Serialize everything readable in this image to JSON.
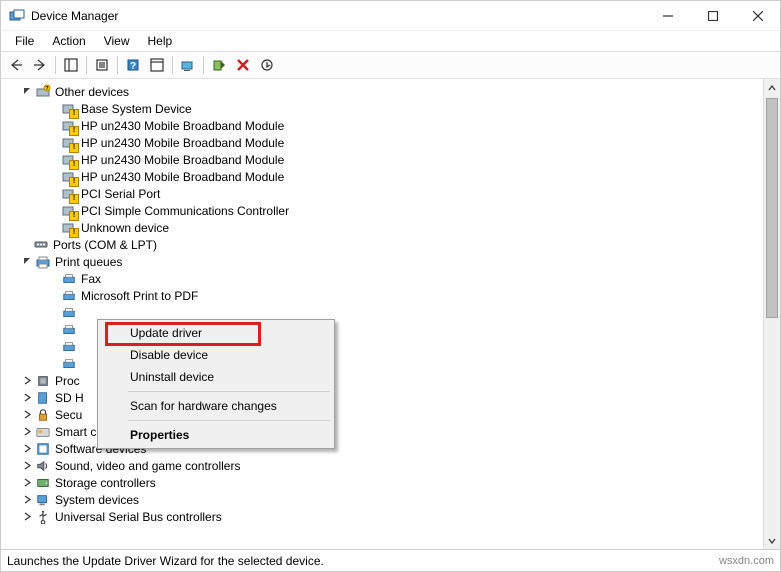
{
  "window": {
    "title": "Device Manager"
  },
  "menubar": {
    "file": "File",
    "action": "Action",
    "view": "View",
    "help": "Help"
  },
  "tree": {
    "other_devices": {
      "label": "Other devices",
      "children": {
        "base_system": "Base System Device",
        "hp1": "HP un2430 Mobile Broadband Module",
        "hp2": "HP un2430 Mobile Broadband Module",
        "hp3": "HP un2430 Mobile Broadband Module",
        "hp4": "HP un2430 Mobile Broadband Module",
        "pci_serial": "PCI Serial Port",
        "pci_simple": "PCI Simple Communications Controller",
        "unknown": "Unknown device"
      }
    },
    "ports": {
      "label": "Ports (COM & LPT)"
    },
    "print_queues": {
      "label": "Print queues",
      "children": {
        "fax": "Fax",
        "mspdf": "Microsoft Print to PDF",
        "p1": "",
        "p2": "",
        "p3": "",
        "p4": ""
      }
    },
    "proc": {
      "label": "Proc"
    },
    "sdh": {
      "label": "SD H"
    },
    "secu": {
      "label": "Secu"
    },
    "smart_card": {
      "label": "Smart card readers"
    },
    "software": {
      "label": "Software devices"
    },
    "sound": {
      "label": "Sound, video and game controllers"
    },
    "storage": {
      "label": "Storage controllers"
    },
    "system": {
      "label": "System devices"
    },
    "usb": {
      "label": "Universal Serial Bus controllers"
    }
  },
  "context_menu": {
    "update": "Update driver",
    "disable": "Disable device",
    "uninstall": "Uninstall device",
    "scan": "Scan for hardware changes",
    "properties": "Properties"
  },
  "statusbar": {
    "text": "Launches the Update Driver Wizard for the selected device.",
    "watermark": "wsxdn.com"
  }
}
